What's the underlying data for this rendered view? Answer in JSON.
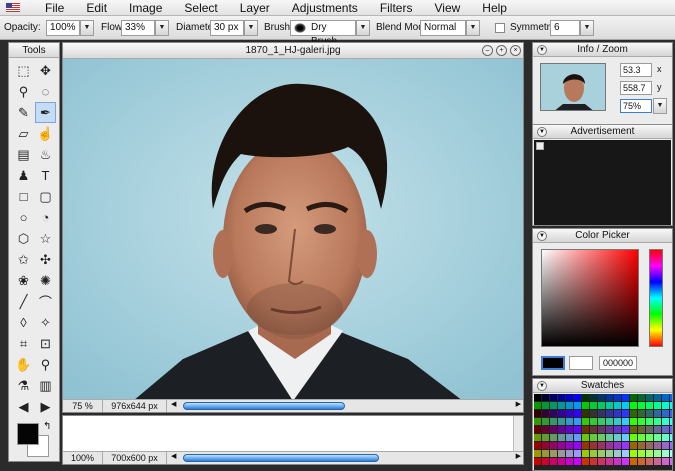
{
  "menubar": {
    "items": [
      "File",
      "Edit",
      "Image",
      "Select",
      "Layer",
      "Adjustments",
      "Filters",
      "View",
      "Help"
    ]
  },
  "options": {
    "opacity_label": "Opacity:",
    "opacity_value": "100%",
    "flow_label": "Flow:",
    "flow_value": "33%",
    "diameter_label": "Diameter:",
    "diameter_value": "30 px",
    "brush_label": "Brush:",
    "brush_value": "Dry Brush",
    "blend_label": "Blend Mode:",
    "blend_value": "Normal",
    "symmetry_label": "Symmetry",
    "symmetry_value": "6"
  },
  "tools": {
    "title": "Tools",
    "icons": [
      "rect-marquee-icon",
      "move-icon",
      "magic-wand-icon",
      "lasso-icon",
      "pencil-icon",
      "brush-icon",
      "eraser-icon",
      "smudge-icon",
      "gradient-icon",
      "bucket-icon",
      "stamp-icon",
      "text-icon",
      "rectangle-icon",
      "rounded-rect-icon",
      "circle-icon",
      "speech-bubble-icon",
      "hexagon-icon",
      "star-icon",
      "star-outline-icon",
      "puzzle-icon",
      "flower-icon",
      "gear-icon",
      "line-icon",
      "curve-icon",
      "blur-drop-icon",
      "burn-icon",
      "crop-icon",
      "resize-icon",
      "hand-icon",
      "zoom-icon",
      "eyedropper-icon",
      "trash-icon",
      "arrow-left-icon",
      "arrow-right-icon"
    ],
    "selected_index": 5,
    "foreground": "#050505",
    "background": "#ffffff"
  },
  "document": {
    "title": "1870_1_HJ-galeri.jpg",
    "zoom": "75 %",
    "size": "976x644 px"
  },
  "history": {
    "zoom": "100%",
    "size": "700x600 px"
  },
  "info": {
    "title": "Info / Zoom",
    "x_value": "53.3",
    "x_label": "x",
    "y_value": "558.7",
    "y_label": "y",
    "zoom_value": "75%"
  },
  "advert": {
    "title": "Advertisement"
  },
  "colorpicker": {
    "title": "Color Picker",
    "hex": "000000"
  },
  "swatches": {
    "title": "Swatches"
  }
}
